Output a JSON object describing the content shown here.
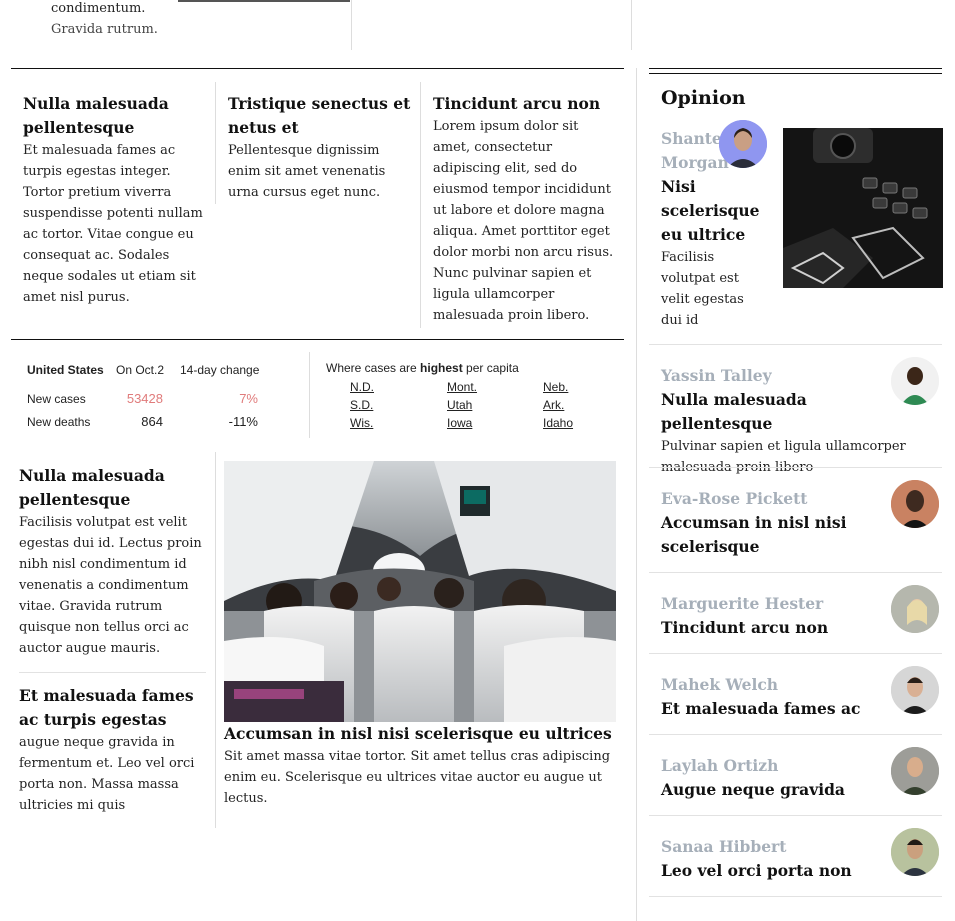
{
  "top": {
    "tail_lines": [
      "condimentum.",
      "Gravida rutrum."
    ]
  },
  "row1": [
    {
      "headline": "Nulla malesuada pellentesque",
      "body": "Et malesuada fames ac turpis egestas integer. Tortor pretium viverra suspendisse potenti nullam ac tortor. Vitae congue eu consequat ac. Sodales neque sodales ut etiam sit amet nisl purus."
    },
    {
      "headline": "Tristique senectus et netus et",
      "body": "Pellentesque dignissim enim sit amet venenatis urna cursus eget nunc."
    },
    {
      "headline": "Tincidunt arcu non",
      "body": "Lorem ipsum dolor sit amet, consectetur adipiscing elit, sed do eiusmod tempor incididunt ut labore et dolore magna aliqua. Amet porttitor eget dolor morbi non arcu risus. Nunc pulvinar sapien et ligula ullamcorper malesuada proin libero."
    }
  ],
  "stats": {
    "headers": {
      "region": "United States",
      "date": "On Oct.2",
      "change": "14-day change"
    },
    "rows": [
      {
        "label": "New cases",
        "value": "53428",
        "change": "7%"
      },
      {
        "label": "New deaths",
        "value": "864",
        "change": "-11%"
      }
    ],
    "highlight_color": "#e07b7b",
    "per_capita_prefix": "Where cases are ",
    "per_capita_strong": "highest",
    "per_capita_suffix": " per capita",
    "states": [
      "N.D.",
      "Mont.",
      "Neb.",
      "S.D.",
      "Utah",
      "Ark.",
      "Wis.",
      "Iowa",
      "Idaho"
    ]
  },
  "row2_left": [
    {
      "headline": "Nulla malesuada pellentesque",
      "body": "Facilisis volutpat est velit egestas dui id. Lectus proin nibh nisl condimentum id venenatis a condimentum vitae. Gravida rutrum quisque non tellus orci ac auctor augue mauris."
    },
    {
      "headline": "Et malesuada fames ac turpis egestas",
      "body": "augue neque gravida in fermentum et. Leo vel orci porta non. Massa massa ultricies mi quis"
    }
  ],
  "feature": {
    "headline": "Accumsan in nisl nisi scelerisque eu ultrices",
    "body": "Sit amet massa vitae tortor. Sit amet tellus cras adipiscing enim eu. Scelerisque eu ultrices vitae auctor eu augue ut lectus."
  },
  "opinion": {
    "heading": "Opinion",
    "lead": {
      "name": "Shantel Morgan",
      "title": "Nisi scelerisque eu ultrice",
      "summary": "Facilisis volutpat est velit egestas dui id"
    },
    "items": [
      {
        "name": "Yassin Talley",
        "title": "Nulla malesuada pellentesque",
        "summary": "Pulvinar sapien et ligula ullamcorper malesuada proin libero"
      },
      {
        "name": "Eva-Rose Pickett",
        "title": "Accumsan in nisl nisi scelerisque",
        "summary": ""
      },
      {
        "name": "Marguerite Hester",
        "title": "Tincidunt arcu non",
        "summary": ""
      },
      {
        "name": "Mahek Welch",
        "title": "Et malesuada fames ac",
        "summary": ""
      },
      {
        "name": "Laylah Ortizh",
        "title": "Augue neque gravida",
        "summary": ""
      },
      {
        "name": "Sanaa Hibbert",
        "title": "Leo vel orci porta non",
        "summary": ""
      }
    ]
  }
}
